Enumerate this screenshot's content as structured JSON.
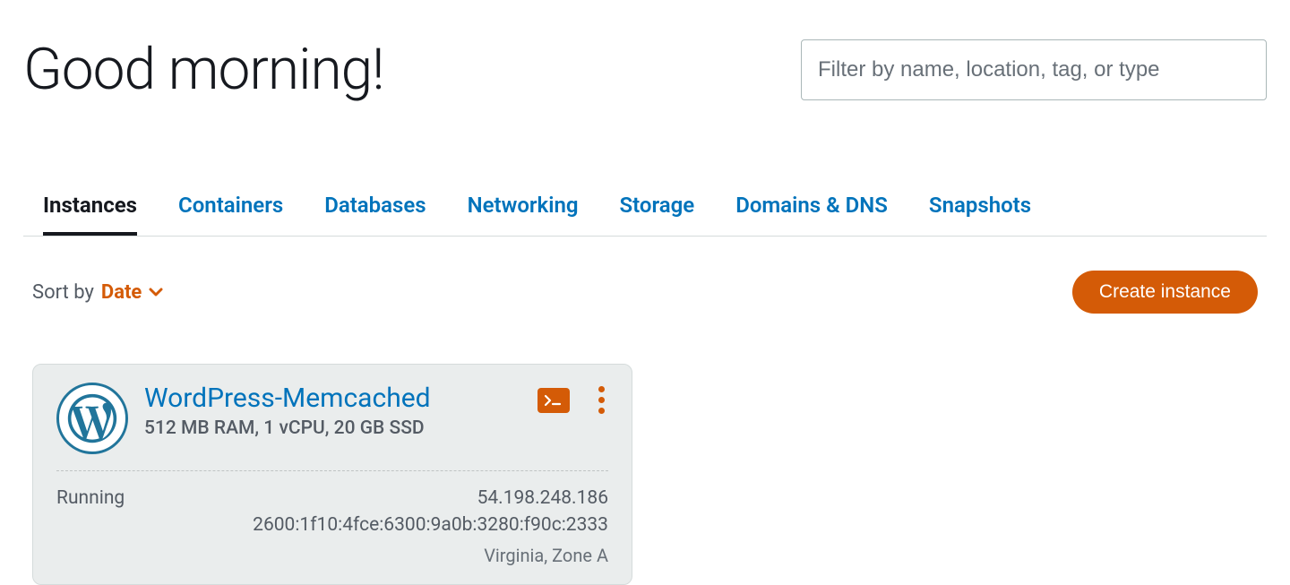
{
  "greeting": "Good morning!",
  "filter_placeholder": "Filter by name, location, tag, or type",
  "tabs": [
    {
      "label": "Instances",
      "active": true
    },
    {
      "label": "Containers",
      "active": false
    },
    {
      "label": "Databases",
      "active": false
    },
    {
      "label": "Networking",
      "active": false
    },
    {
      "label": "Storage",
      "active": false
    },
    {
      "label": "Domains & DNS",
      "active": false
    },
    {
      "label": "Snapshots",
      "active": false
    }
  ],
  "sort": {
    "label": "Sort by",
    "value": "Date"
  },
  "create_button": "Create instance",
  "instance": {
    "name": "WordPress-Memcached",
    "spec": "512 MB RAM, 1 vCPU, 20 GB SSD",
    "status": "Running",
    "ipv4": "54.198.248.186",
    "ipv6": "2600:1f10:4fce:6300:9a0b:3280:f90c:2333",
    "region": "Virginia, Zone A",
    "app_icon": "wordpress-icon",
    "terminal_label": ">_"
  },
  "colors": {
    "accent_blue": "#0073bb",
    "accent_orange": "#d45b07",
    "card_bg": "#eaeded"
  }
}
